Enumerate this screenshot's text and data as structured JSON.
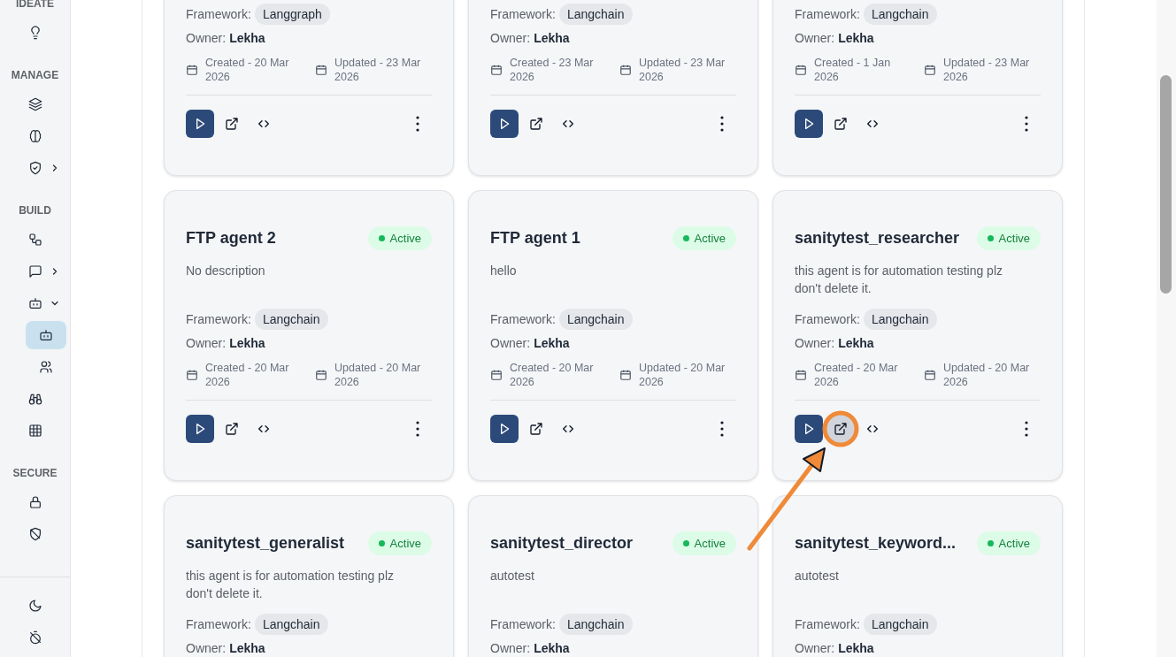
{
  "sidebar": {
    "sections": [
      {
        "label": "IDEATE",
        "items": [
          {
            "selected": false
          }
        ]
      },
      {
        "label": "MANAGE",
        "items": [
          {
            "selected": false
          },
          {
            "selected": false
          },
          {
            "selected": false,
            "expanded": false
          }
        ]
      },
      {
        "label": "BUILD",
        "items": [
          {
            "selected": false
          },
          {
            "selected": false,
            "expanded": false
          },
          {
            "selected": false,
            "expanded": true,
            "children": [
              {
                "selected": true
              },
              {
                "selected": false
              }
            ]
          },
          {
            "selected": false
          },
          {
            "selected": false
          }
        ]
      },
      {
        "label": "SECURE",
        "items": [
          {
            "selected": false
          },
          {
            "selected": false
          }
        ]
      }
    ],
    "footer_items": [
      {
        "selected": false
      },
      {
        "selected": false
      }
    ]
  },
  "agents": [
    {
      "framework": "Langgraph",
      "owner_label": "Owner:",
      "owner": "Lekha",
      "framework_label": "Framework:",
      "created": "Created - 20 Mar 2026",
      "updated": "Updated - 23 Mar 2026"
    },
    {
      "framework": "Langchain",
      "owner_label": "Owner:",
      "owner": "Lekha",
      "framework_label": "Framework:",
      "created": "Created - 23 Mar 2026",
      "updated": "Updated - 23 Mar 2026"
    },
    {
      "framework": "Langchain",
      "owner_label": "Owner:",
      "owner": "Lekha",
      "framework_label": "Framework:",
      "created": "Created - 1 Jan 2026",
      "updated": "Updated - 23 Mar 2026"
    },
    {
      "title": "FTP agent 2",
      "status": "Active",
      "status_active": true,
      "description": "No description",
      "framework_label": "Framework:",
      "framework": "Langchain",
      "owner_label": "Owner:",
      "owner": "Lekha",
      "created": "Created - 20 Mar 2026",
      "updated": "Updated - 20 Mar 2026"
    },
    {
      "title": "FTP agent 1",
      "status": "Active",
      "status_active": true,
      "description": "hello",
      "framework_label": "Framework:",
      "framework": "Langchain",
      "owner_label": "Owner:",
      "owner": "Lekha",
      "created": "Created - 20 Mar 2026",
      "updated": "Updated - 20 Mar 2026"
    },
    {
      "title": "sanitytest_researcher",
      "status": "Active",
      "status_active": true,
      "description": "this agent is for automation testing plz don't delete it.",
      "framework_label": "Framework:",
      "framework": "Langchain",
      "owner_label": "Owner:",
      "owner": "Lekha",
      "created": "Created - 20 Mar 2026",
      "updated": "Updated - 20 Mar 2026",
      "annotated": true
    },
    {
      "title": "sanitytest_generalist",
      "status": "Active",
      "status_active": true,
      "description": "this agent is for automation testing plz don't delete it.",
      "framework_label": "Framework:",
      "framework": "Langchain",
      "owner_label": "Owner:",
      "owner": "Lekha"
    },
    {
      "title": "sanitytest_director",
      "status": "Active",
      "status_active": true,
      "description": "autotest",
      "framework_label": "Framework:",
      "framework": "Langchain",
      "owner_label": "Owner:",
      "owner": "Lekha"
    },
    {
      "title": "sanitytest_keyword...",
      "status": "Active",
      "status_active": true,
      "description": "autotest",
      "framework_label": "Framework:",
      "framework": "Langchain",
      "owner_label": "Owner:",
      "owner": "Lekha"
    }
  ]
}
